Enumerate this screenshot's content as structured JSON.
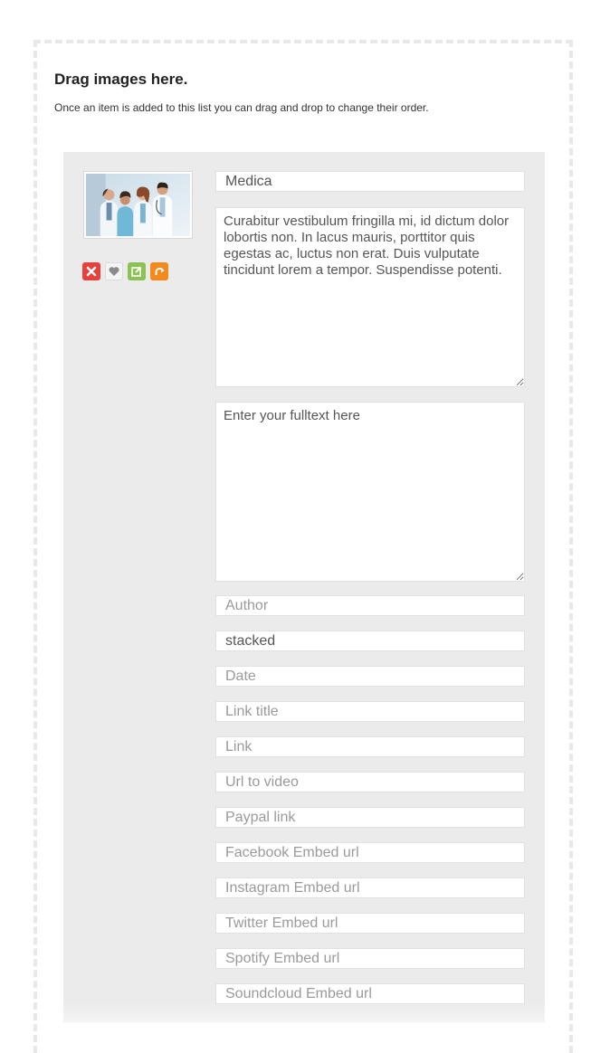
{
  "dropzone": {
    "title": "Drag images here.",
    "subtitle": "Once an item is added to this list you can drag and drop to change their order."
  },
  "item": {
    "thumbnail_icon": "medical-team-photo",
    "actions": [
      {
        "name": "delete",
        "icon": "x-icon",
        "color": "#e8413b"
      },
      {
        "name": "favorite",
        "icon": "heart-icon",
        "color": "#f4f4f4"
      },
      {
        "name": "edit",
        "icon": "edit-icon",
        "color": "#8cc251"
      },
      {
        "name": "rotate",
        "icon": "rotate-icon",
        "color": "#f28a1d"
      }
    ],
    "title_value": "Medica",
    "description_value": "Curabitur vestibulum fringilla mi, id dictum dolor lobortis non. In lacus mauris, porttitor quis egestas ac, luctus non erat. Duis vulputate tincidunt lorem a tempor. Suspendisse potenti.",
    "fulltext_placeholder": "Enter your fulltext here",
    "author_placeholder": "Author",
    "layout_value": "stacked",
    "date_placeholder": "Date",
    "link_title_placeholder": "Link title",
    "link_placeholder": "Link",
    "video_url_placeholder": "Url to video",
    "paypal_placeholder": "Paypal link",
    "facebook_placeholder": "Facebook Embed url",
    "instagram_placeholder": "Instagram Embed url",
    "twitter_placeholder": "Twitter Embed url",
    "spotify_placeholder": "Spotify Embed url",
    "soundcloud_placeholder": "Soundcloud Embed url"
  }
}
